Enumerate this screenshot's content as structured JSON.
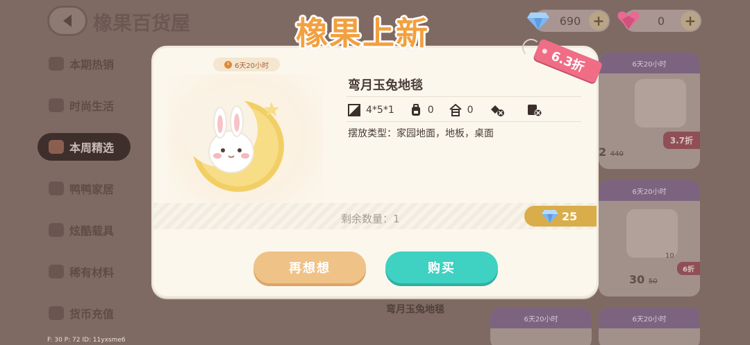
{
  "header": {
    "store_title": "橡果百货屋",
    "banner": "橡果上新",
    "currency": [
      {
        "icon": "blue-diamond-icon",
        "amount": "690"
      },
      {
        "icon": "pink-heart-gem-icon",
        "amount": "0"
      }
    ],
    "plus_symbol": "+"
  },
  "sidebar": {
    "items": [
      {
        "label": "本期热销",
        "icon": "hot-sale-icon"
      },
      {
        "label": "时尚生活",
        "icon": "fashion-icon"
      },
      {
        "label": "本周精选",
        "icon": "weekly-pick-icon",
        "active": true
      },
      {
        "label": "鸭鸭家居",
        "icon": "duck-home-icon"
      },
      {
        "label": "炫酷载具",
        "icon": "vehicle-icon"
      },
      {
        "label": "稀有材料",
        "icon": "rare-material-icon"
      },
      {
        "label": "货币充值",
        "icon": "currency-recharge-icon"
      }
    ]
  },
  "background_cards": [
    {
      "timer": "6天20小时",
      "price": "2",
      "old_price": "440",
      "discount": "3.7折"
    },
    {
      "timer": "6天20小时",
      "price": "30",
      "old_price": "50",
      "discount": "6折",
      "count": "10"
    },
    {
      "timer": "6天20小时"
    },
    {
      "timer": "6天20小时"
    }
  ],
  "background_item_label": "弯月玉兔地毯",
  "debug_text": "F: 30    P: 72    ID: 11yxsme6",
  "modal": {
    "timer": "6天20小时",
    "discount_tag": "6.3折",
    "product_name": "弯月玉兔地毯",
    "attributes": {
      "size": "4*5*1",
      "backpack": "0",
      "house": "0"
    },
    "placement_text": "摆放类型：家园地面，地板，桌面",
    "remaining_text": "剩余数量：1",
    "price": "25",
    "think_again_button": "再想想",
    "buy_button": "购买"
  },
  "colors": {
    "buy_button": "#3fd1c1",
    "think_button": "#efc287",
    "price_flag": "#d9ad4a",
    "discount_tag": "#f06d86",
    "banner_text": "#f2a040"
  }
}
